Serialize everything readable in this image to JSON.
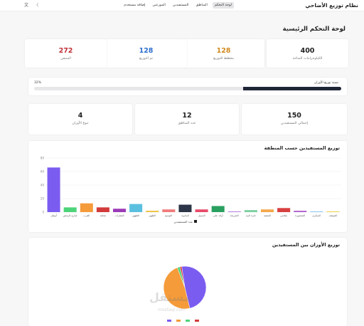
{
  "header": {
    "app_title": "نظام توزيع الأضاحي",
    "nav": [
      {
        "label": "لوحة التحكم",
        "active": true
      },
      {
        "label": "المناطق",
        "active": false
      },
      {
        "label": "المستفيدين",
        "active": false
      },
      {
        "label": "الموزعين",
        "active": false
      },
      {
        "label": "إضافة مستخدم",
        "active": false
      }
    ],
    "icons": [
      "moon-icon",
      "translate-icon"
    ]
  },
  "main": {
    "title": "لوحة التحكم الرئيسية",
    "stats_top": [
      {
        "value": "400",
        "label": "الكيلوجرامات المتاحة",
        "color": "#222222"
      },
      {
        "value": "128",
        "label": "مخطط للتوزيع",
        "color": "#d18a1e"
      },
      {
        "value": "128",
        "label": "تم التوزيع",
        "color": "#2f6fd0"
      },
      {
        "value": "272",
        "label": "المتبقي",
        "color": "#c0323a"
      }
    ],
    "progress": {
      "label": "نسبة توزيع الأوزان",
      "percent_text": "32%",
      "value": 0.32
    },
    "stats_bottom": [
      {
        "value": "150",
        "label": "إجمالي المستفيدين"
      },
      {
        "value": "12",
        "label": "عدد المناطق"
      },
      {
        "value": "4",
        "label": "تنوع الأوزان"
      }
    ]
  },
  "chart_data": [
    {
      "type": "bar",
      "title": "توزيع المستفيدين حسب المنطقة",
      "legend": "عدد المستفيدين",
      "ylim": [
        0,
        80
      ],
      "yticks": [
        0,
        20,
        40,
        60,
        80
      ],
      "categories": [
        "أبوليل",
        "شارع الرمش",
        "القرب",
        "معاهد",
        "المعارات",
        "الظهور",
        "الظهير",
        "التوسع",
        "البداوية",
        "السبيل",
        "أولاد علي",
        "الشريعة",
        "جارة البيه",
        "المنفية",
        "بلقاس",
        "المنصورة",
        "السكري",
        "الجوهف"
      ],
      "values": [
        66,
        7,
        13,
        7,
        5,
        12,
        2,
        4,
        11,
        4,
        9,
        1,
        3,
        4,
        6,
        2,
        1,
        1
      ],
      "colors": [
        "#7b5cf0",
        "#4dd47a",
        "#f59b3a",
        "#d33a3a",
        "#9b3ab8",
        "#5bc0e0",
        "#f0c040",
        "#f07a7a",
        "#2d3648",
        "#e84a6a",
        "#2aa060",
        "#b07be0",
        "#7ad0a0",
        "#f5a84a",
        "#d84040",
        "#b060d0",
        "#80c8f0",
        "#f0d040"
      ]
    },
    {
      "type": "pie",
      "title": "توزيع الأوزان بين المستفيدين",
      "series_labels": [
        "1",
        "2",
        "3",
        "4"
      ],
      "values": [
        73,
        72,
        3,
        2
      ],
      "colors": [
        "#7b5cf0",
        "#f59b3a",
        "#4dd47a",
        "#d33a3a"
      ]
    }
  ],
  "watermark": {
    "text": "مستقل",
    "sub": "mostaql.com"
  }
}
